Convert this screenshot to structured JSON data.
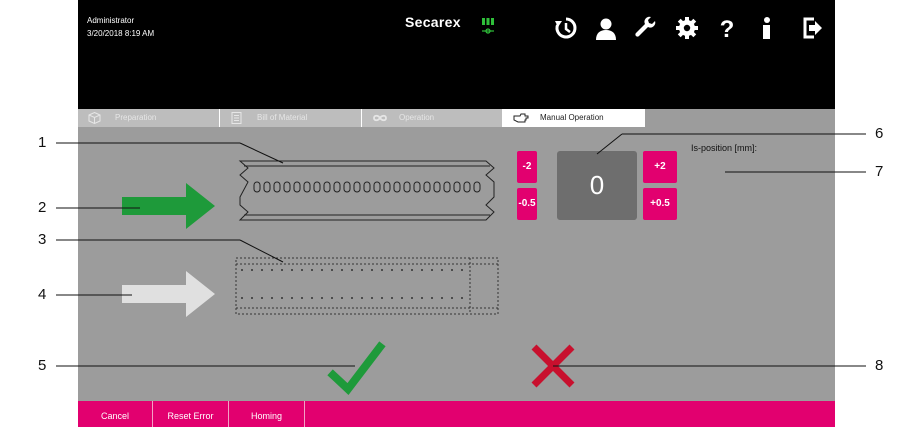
{
  "header": {
    "user": "Administrator",
    "datetime": "3/20/2018 8:19 AM",
    "brand": "Secarex",
    "icons": [
      "history-icon",
      "user-icon",
      "wrench-icon",
      "gear-icon",
      "help-icon",
      "info-icon",
      "logout-icon"
    ]
  },
  "tabs": [
    {
      "label": "Preparation",
      "icon": "cube-icon",
      "active": false
    },
    {
      "label": "Bill of Material",
      "icon": "list-icon",
      "active": false
    },
    {
      "label": "Operation",
      "icon": "infinity-icon",
      "active": false
    },
    {
      "label": "Manual Operation",
      "icon": "hand-icon",
      "active": true
    }
  ],
  "position": {
    "value": "0",
    "label": "Is-position [mm]:",
    "buttons": {
      "minus2": "-2",
      "minus05": "-0.5",
      "plus2": "+2",
      "plus05": "+0.5"
    }
  },
  "bottombar": {
    "items": [
      "Cancel",
      "Reset Error",
      "Homing"
    ]
  },
  "callouts": [
    "1",
    "2",
    "3",
    "4",
    "5",
    "6",
    "7",
    "8"
  ],
  "colors": {
    "accent": "#e2006f",
    "ok": "#1e9a3a",
    "cancel": "#c8102e"
  }
}
